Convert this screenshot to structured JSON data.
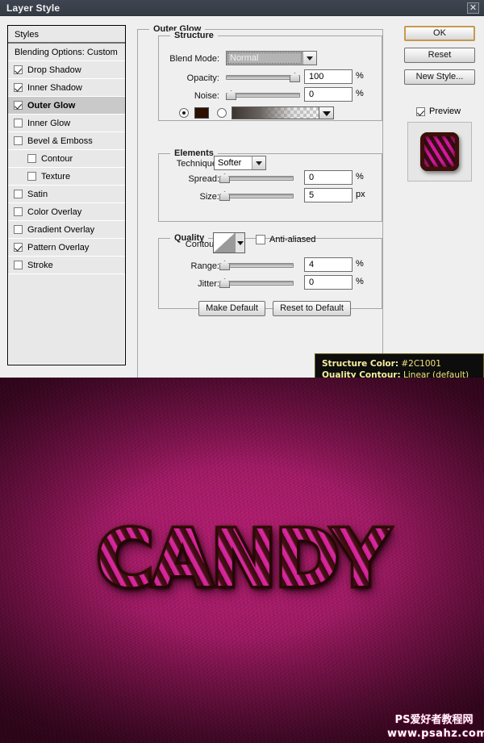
{
  "window": {
    "title": "Layer Style",
    "close_label": "✕"
  },
  "styles_panel": {
    "header": "Styles",
    "blending_options": "Blending Options: Custom",
    "items": [
      {
        "label": "Drop Shadow",
        "checked": true,
        "selected": false,
        "indent": false
      },
      {
        "label": "Inner Shadow",
        "checked": true,
        "selected": false,
        "indent": false
      },
      {
        "label": "Outer Glow",
        "checked": true,
        "selected": true,
        "indent": false
      },
      {
        "label": "Inner Glow",
        "checked": false,
        "selected": false,
        "indent": false
      },
      {
        "label": "Bevel & Emboss",
        "checked": false,
        "selected": false,
        "indent": false
      },
      {
        "label": "Contour",
        "checked": false,
        "selected": false,
        "indent": true
      },
      {
        "label": "Texture",
        "checked": false,
        "selected": false,
        "indent": true
      },
      {
        "label": "Satin",
        "checked": false,
        "selected": false,
        "indent": false
      },
      {
        "label": "Color Overlay",
        "checked": false,
        "selected": false,
        "indent": false
      },
      {
        "label": "Gradient Overlay",
        "checked": false,
        "selected": false,
        "indent": false
      },
      {
        "label": "Pattern Overlay",
        "checked": true,
        "selected": false,
        "indent": false
      },
      {
        "label": "Stroke",
        "checked": false,
        "selected": false,
        "indent": false
      }
    ]
  },
  "panel": {
    "title": "Outer Glow",
    "structure": {
      "legend": "Structure",
      "blend_mode_label": "Blend Mode:",
      "blend_mode_value": "Normal",
      "opacity_label": "Opacity:",
      "opacity_value": "100",
      "opacity_unit": "%",
      "noise_label": "Noise:",
      "noise_value": "0",
      "noise_unit": "%",
      "color_swatch": "#2C1001"
    },
    "elements": {
      "legend": "Elements",
      "technique_label": "Technique:",
      "technique_value": "Softer",
      "spread_label": "Spread:",
      "spread_value": "0",
      "spread_unit": "%",
      "size_label": "Size:",
      "size_value": "5",
      "size_unit": "px"
    },
    "quality": {
      "legend": "Quality",
      "contour_label": "Contour:",
      "anti_aliased_label": "Anti-aliased",
      "anti_aliased_checked": false,
      "range_label": "Range:",
      "range_value": "4",
      "range_unit": "%",
      "jitter_label": "Jitter:",
      "jitter_value": "0",
      "jitter_unit": "%"
    },
    "make_default": "Make Default",
    "reset_to_default": "Reset to Default"
  },
  "actions": {
    "ok": "OK",
    "reset": "Reset",
    "new_style": "New Style...",
    "preview_label": "Preview",
    "preview_checked": true
  },
  "tooltip": {
    "line1_key": "Structure Color:",
    "line1_value": "#2C1001",
    "line2_key": "Quality Contour:",
    "line2_value": "Linear (default)"
  },
  "artwork": {
    "text": "CANDY",
    "background_color": "#a41765",
    "stripe_color": "#d4189c",
    "stripe_dark_color": "#3a0d17"
  },
  "watermark": {
    "line1": "PS爱好者教程网",
    "line2": "www.psahz.com"
  }
}
